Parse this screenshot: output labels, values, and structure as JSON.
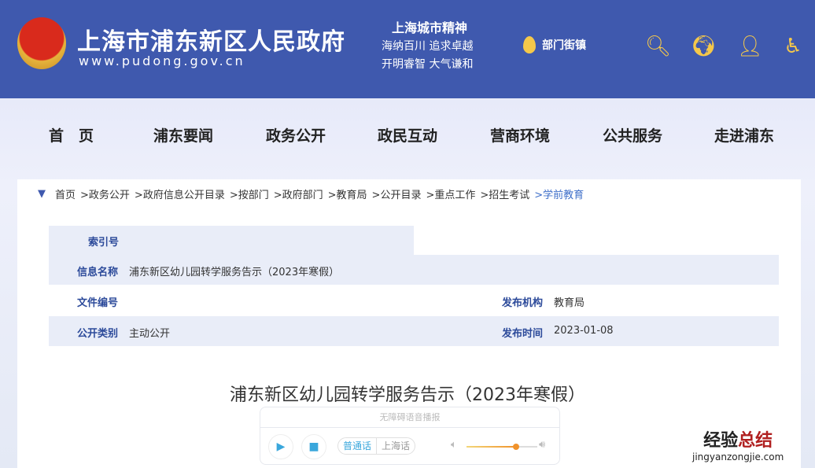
{
  "header": {
    "title": "上海市浦东新区人民政府",
    "url": "www.pudong.gov.cn",
    "spirit_title": "上海城市精神",
    "spirit_lines": [
      "海纳百川  追求卓越",
      "开明睿智  大气谦和"
    ],
    "dept_label": "部门街镇"
  },
  "nav": [
    "首　页",
    "浦东要闻",
    "政务公开",
    "政民互动",
    "营商环境",
    "公共服务",
    "走进浦东"
  ],
  "breadcrumb": {
    "items": [
      "首页",
      ">政务公开",
      ">政府信息公开目录",
      ">按部门",
      ">政府部门",
      ">教育局",
      ">公开目录",
      ">重点工作",
      ">招生考试"
    ],
    "current": ">学前教育"
  },
  "meta": {
    "index_label": "索引号",
    "index_value": "",
    "name_label": "信息名称",
    "name_value": "浦东新区幼儿园转学服务告示（2023年寒假）",
    "file_label": "文件编号",
    "file_value": "",
    "org_label": "发布机构",
    "org_value": "教育局",
    "category_label": "公开类别",
    "category_value": "主动公开",
    "date_label": "发布时间",
    "date_value": "2023-01-08"
  },
  "doc_title": "浦东新区幼儿园转学服务告示（2023年寒假）",
  "player": {
    "title": "无障碍语音播报",
    "lang_active": "普通话",
    "lang_other": "上海话",
    "volume": 0.7
  },
  "watermark": {
    "line1a": "经验",
    "line1b": "总结",
    "line2": "jingyanzongjie.com"
  }
}
